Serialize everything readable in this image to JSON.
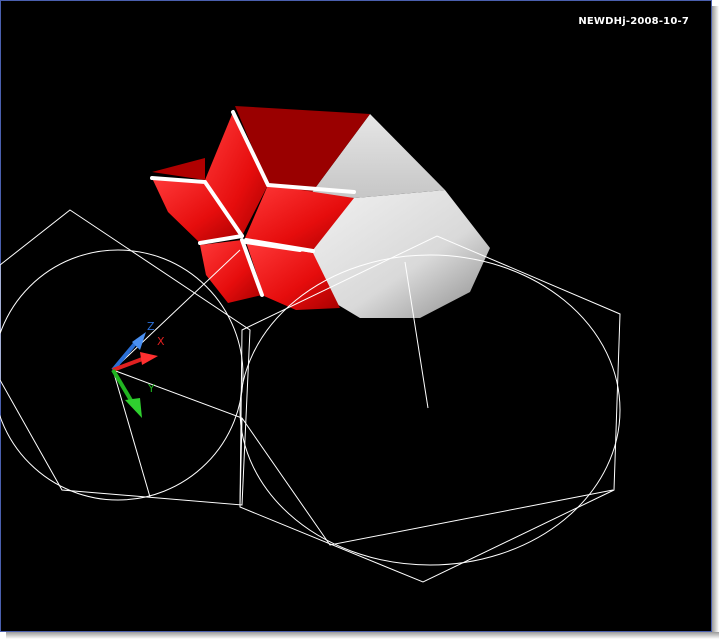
{
  "viewport": {
    "stamp_text": "NEWDHj-2008-10-7",
    "background": "#000000",
    "border_color": "#4a5fae"
  },
  "ucs": {
    "x_label": "X",
    "y_label": "Y",
    "z_label": "Z",
    "x_color": "#e02020",
    "y_color": "#21b421",
    "z_color": "#2a6fd6"
  },
  "model": {
    "solid_color": "#e01010",
    "solid_shade": "#9a0000",
    "white_color": "#e8e8e8",
    "wire_color": "#ffffff"
  }
}
